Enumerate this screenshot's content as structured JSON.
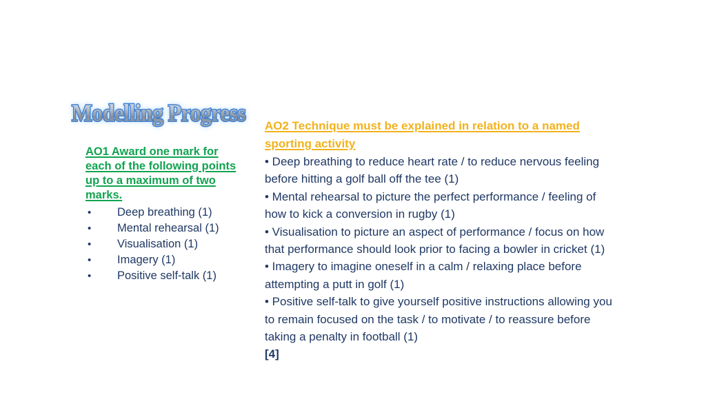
{
  "slide": {
    "background_color": "#FFFFFF",
    "title": "Modelling Progress",
    "title_style": {
      "fill_color": "#9AA3AE",
      "outline_color": "#3D7FD4",
      "glow_color": "#BFDCFA"
    }
  },
  "left_column": {
    "heading": "AO1 Award one mark for each of the following points up to a maximum of two marks.",
    "heading_color": "#12A350",
    "bullet_glyph": "•",
    "bullet_color": "#1F3864",
    "items": [
      {
        "text": "Deep breathing (1)"
      },
      {
        "text": "Mental rehearsal (1)"
      },
      {
        "text": "Visualisation (1)"
      },
      {
        "text": "Imagery (1)"
      },
      {
        "text": "Positive self-talk (1)"
      }
    ]
  },
  "right_column": {
    "heading_line_1": "AO2 Technique must be explained in relation to a named",
    "heading_line_2": "sporting activity",
    "heading_color": "#F2B21C",
    "body_color": "#1F3864",
    "points": [
      {
        "text": "•  Deep breathing to reduce heart rate / to reduce nervous feeling before hitting a golf ball off the tee (1)"
      },
      {
        "text": "• Mental rehearsal to picture the perfect performance / feeling of how to kick a conversion in rugby (1)"
      },
      {
        "text": "•  Visualisation to picture an aspect of performance / focus on how that performance should look prior to facing a bowler in cricket (1)"
      },
      {
        "text": "• Imagery to imagine oneself in a calm / relaxing place before attempting a putt in golf (1)"
      },
      {
        "text": "•  Positive self-talk to give yourself positive instructions allowing you to remain focused on the task / to motivate / to reassure before taking a penalty in football (1)"
      }
    ],
    "total_marks": "[4]"
  }
}
